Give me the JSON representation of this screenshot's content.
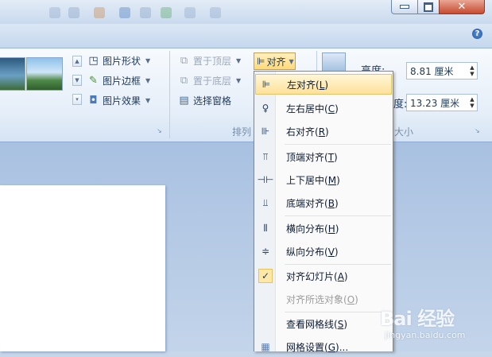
{
  "window": {
    "minimize_icon": "minimize-icon",
    "restore_icon": "restore-icon",
    "close_icon": "close-icon",
    "help_label": "?"
  },
  "picture_styles": {
    "shape_label": "图片形状",
    "border_label": "图片边框",
    "effect_label": "图片效果"
  },
  "arrange": {
    "bring_front_label": "置于顶层",
    "send_back_label": "置于底层",
    "selection_pane_label": "选择窗格",
    "align_label": "对齐",
    "group_label": "排列"
  },
  "size": {
    "height_label": "高度:",
    "height_value": "8.81 厘米",
    "width_label": "宽度:",
    "width_value": "13.23 厘米",
    "group_label": "大小"
  },
  "align_menu": {
    "items": [
      {
        "label": "左对齐",
        "key": "L",
        "icon": "align-left-icon",
        "state": "hover"
      },
      {
        "label": "左右居中",
        "key": "C",
        "icon": "align-center-icon"
      },
      {
        "label": "右对齐",
        "key": "R",
        "icon": "align-right-icon"
      },
      {
        "label": "顶端对齐",
        "key": "T",
        "icon": "align-top-icon"
      },
      {
        "label": "上下居中",
        "key": "M",
        "icon": "align-middle-icon"
      },
      {
        "label": "底端对齐",
        "key": "B",
        "icon": "align-bottom-icon"
      },
      {
        "label": "横向分布",
        "key": "H",
        "icon": "distribute-horizontal-icon"
      },
      {
        "label": "纵向分布",
        "key": "V",
        "icon": "distribute-vertical-icon"
      },
      {
        "label": "对齐幻灯片",
        "key": "A",
        "icon": "check-icon",
        "state": "checked"
      },
      {
        "label": "对齐所选对象",
        "key": "O",
        "icon": "",
        "state": "disabled"
      },
      {
        "label": "查看网格线",
        "key": "S",
        "icon": ""
      },
      {
        "label": "网格设置",
        "key": "G",
        "suffix": "...",
        "icon": "grid-icon"
      }
    ]
  },
  "watermark": {
    "text": "Bai 经验",
    "sub": "jingyan.baidu.com"
  },
  "colors": {
    "ribbon_bg": "#e5eef9",
    "hover_bg": "#ffe19a",
    "doc_bg": "#b7cbe6"
  }
}
